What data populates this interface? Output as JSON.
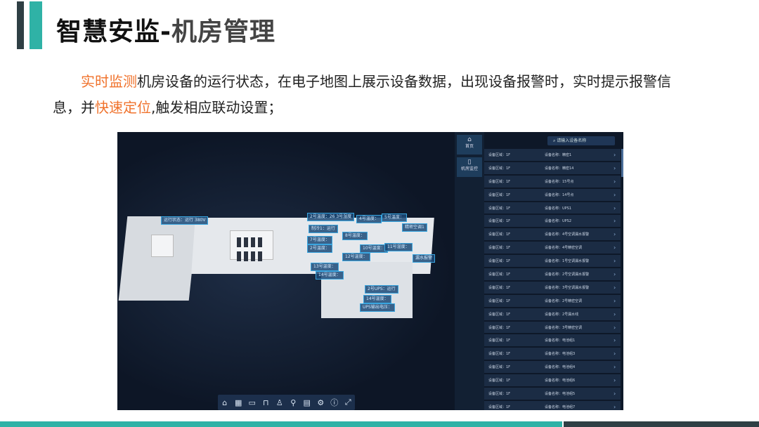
{
  "slide": {
    "title_main": "智慧安监",
    "title_sep": "-",
    "title_sub": "机房管理",
    "desc_hl1": "实时监测",
    "desc_part1": "机房设备的运行状态，在电子地图上展示设备数据，出现设备报警时，实时提示报警信息，并",
    "desc_hl2": "快速定位",
    "desc_part2": ",触发相应联动设置；"
  },
  "screenshot": {
    "nav": {
      "home_label": "首页",
      "monitor_label": "机房监控"
    },
    "search_placeholder": "请输入设备名称",
    "tags": [
      "运行状态：运行 380V",
      "2号温度：26 3号湿度",
      "4号温度：",
      "5号温度：",
      "制冷1：运行",
      "7号温度：",
      "8号温度：",
      "精密空调1",
      "2号温度：",
      "10号温度：",
      "11号湿度：",
      "12号温度：",
      "13号温度：",
      "14号温度：",
      "漏水报警",
      "2号UPS：运行",
      "14号温度：",
      "UPS输出电压："
    ],
    "list": [
      {
        "area": "设备区域：1F",
        "name": "设备名称：精密1"
      },
      {
        "area": "设备区域：1F",
        "name": "设备名称：精密14"
      },
      {
        "area": "设备区域：1F",
        "name": "设备名称：15号点"
      },
      {
        "area": "设备区域：1F",
        "name": "设备名称：14号点"
      },
      {
        "area": "设备区域：1F",
        "name": "设备名称：UPS1"
      },
      {
        "area": "设备区域：1F",
        "name": "设备名称：UPS2"
      },
      {
        "area": "设备区域：1F",
        "name": "设备名称：4号空调漏水报警"
      },
      {
        "area": "设备区域：1F",
        "name": "设备名称：4号精密空调"
      },
      {
        "area": "设备区域：1F",
        "name": "设备名称：1号空调漏水报警"
      },
      {
        "area": "设备区域：1F",
        "name": "设备名称：2号空调漏水报警"
      },
      {
        "area": "设备区域：1F",
        "name": "设备名称：3号空调漏水报警"
      },
      {
        "area": "设备区域：1F",
        "name": "设备名称：2号精密空调"
      },
      {
        "area": "设备区域：1F",
        "name": "设备名称：2号漏水线"
      },
      {
        "area": "设备区域：1F",
        "name": "设备名称：3号精密空调"
      },
      {
        "area": "设备区域：1F",
        "name": "设备名称：电池组1"
      },
      {
        "area": "设备区域：1F",
        "name": "设备名称：电池组3"
      },
      {
        "area": "设备区域：1F",
        "name": "设备名称：电池组4"
      },
      {
        "area": "设备区域：1F",
        "name": "设备名称：电池组6"
      },
      {
        "area": "设备区域：1F",
        "name": "设备名称：电池组5"
      },
      {
        "area": "设备区域：1F",
        "name": "设备名称：电池组7"
      }
    ],
    "toolbar_icons": [
      "home-icon",
      "map-icon",
      "ruler-icon",
      "tag-icon",
      "person-icon",
      "pin-icon",
      "grid-icon",
      "gear-icon",
      "info-icon",
      "expand-icon"
    ],
    "colors": {
      "accent": "#2fb2a6",
      "highlight": "#f0732d",
      "panel": "#0e1828"
    }
  }
}
